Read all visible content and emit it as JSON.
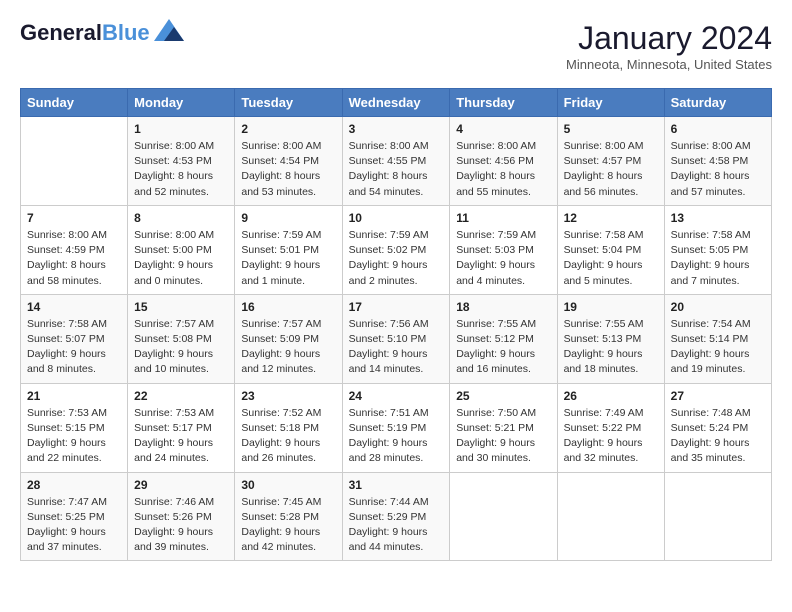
{
  "header": {
    "logo_line1": "General",
    "logo_line2": "Blue",
    "month": "January 2024",
    "location": "Minneota, Minnesota, United States"
  },
  "weekdays": [
    "Sunday",
    "Monday",
    "Tuesday",
    "Wednesday",
    "Thursday",
    "Friday",
    "Saturday"
  ],
  "weeks": [
    [
      {
        "day": "",
        "sunrise": "",
        "sunset": "",
        "daylight": ""
      },
      {
        "day": "1",
        "sunrise": "Sunrise: 8:00 AM",
        "sunset": "Sunset: 4:53 PM",
        "daylight": "Daylight: 8 hours and 52 minutes."
      },
      {
        "day": "2",
        "sunrise": "Sunrise: 8:00 AM",
        "sunset": "Sunset: 4:54 PM",
        "daylight": "Daylight: 8 hours and 53 minutes."
      },
      {
        "day": "3",
        "sunrise": "Sunrise: 8:00 AM",
        "sunset": "Sunset: 4:55 PM",
        "daylight": "Daylight: 8 hours and 54 minutes."
      },
      {
        "day": "4",
        "sunrise": "Sunrise: 8:00 AM",
        "sunset": "Sunset: 4:56 PM",
        "daylight": "Daylight: 8 hours and 55 minutes."
      },
      {
        "day": "5",
        "sunrise": "Sunrise: 8:00 AM",
        "sunset": "Sunset: 4:57 PM",
        "daylight": "Daylight: 8 hours and 56 minutes."
      },
      {
        "day": "6",
        "sunrise": "Sunrise: 8:00 AM",
        "sunset": "Sunset: 4:58 PM",
        "daylight": "Daylight: 8 hours and 57 minutes."
      }
    ],
    [
      {
        "day": "7",
        "sunrise": "Sunrise: 8:00 AM",
        "sunset": "Sunset: 4:59 PM",
        "daylight": "Daylight: 8 hours and 58 minutes."
      },
      {
        "day": "8",
        "sunrise": "Sunrise: 8:00 AM",
        "sunset": "Sunset: 5:00 PM",
        "daylight": "Daylight: 9 hours and 0 minutes."
      },
      {
        "day": "9",
        "sunrise": "Sunrise: 7:59 AM",
        "sunset": "Sunset: 5:01 PM",
        "daylight": "Daylight: 9 hours and 1 minute."
      },
      {
        "day": "10",
        "sunrise": "Sunrise: 7:59 AM",
        "sunset": "Sunset: 5:02 PM",
        "daylight": "Daylight: 9 hours and 2 minutes."
      },
      {
        "day": "11",
        "sunrise": "Sunrise: 7:59 AM",
        "sunset": "Sunset: 5:03 PM",
        "daylight": "Daylight: 9 hours and 4 minutes."
      },
      {
        "day": "12",
        "sunrise": "Sunrise: 7:58 AM",
        "sunset": "Sunset: 5:04 PM",
        "daylight": "Daylight: 9 hours and 5 minutes."
      },
      {
        "day": "13",
        "sunrise": "Sunrise: 7:58 AM",
        "sunset": "Sunset: 5:05 PM",
        "daylight": "Daylight: 9 hours and 7 minutes."
      }
    ],
    [
      {
        "day": "14",
        "sunrise": "Sunrise: 7:58 AM",
        "sunset": "Sunset: 5:07 PM",
        "daylight": "Daylight: 9 hours and 8 minutes."
      },
      {
        "day": "15",
        "sunrise": "Sunrise: 7:57 AM",
        "sunset": "Sunset: 5:08 PM",
        "daylight": "Daylight: 9 hours and 10 minutes."
      },
      {
        "day": "16",
        "sunrise": "Sunrise: 7:57 AM",
        "sunset": "Sunset: 5:09 PM",
        "daylight": "Daylight: 9 hours and 12 minutes."
      },
      {
        "day": "17",
        "sunrise": "Sunrise: 7:56 AM",
        "sunset": "Sunset: 5:10 PM",
        "daylight": "Daylight: 9 hours and 14 minutes."
      },
      {
        "day": "18",
        "sunrise": "Sunrise: 7:55 AM",
        "sunset": "Sunset: 5:12 PM",
        "daylight": "Daylight: 9 hours and 16 minutes."
      },
      {
        "day": "19",
        "sunrise": "Sunrise: 7:55 AM",
        "sunset": "Sunset: 5:13 PM",
        "daylight": "Daylight: 9 hours and 18 minutes."
      },
      {
        "day": "20",
        "sunrise": "Sunrise: 7:54 AM",
        "sunset": "Sunset: 5:14 PM",
        "daylight": "Daylight: 9 hours and 19 minutes."
      }
    ],
    [
      {
        "day": "21",
        "sunrise": "Sunrise: 7:53 AM",
        "sunset": "Sunset: 5:15 PM",
        "daylight": "Daylight: 9 hours and 22 minutes."
      },
      {
        "day": "22",
        "sunrise": "Sunrise: 7:53 AM",
        "sunset": "Sunset: 5:17 PM",
        "daylight": "Daylight: 9 hours and 24 minutes."
      },
      {
        "day": "23",
        "sunrise": "Sunrise: 7:52 AM",
        "sunset": "Sunset: 5:18 PM",
        "daylight": "Daylight: 9 hours and 26 minutes."
      },
      {
        "day": "24",
        "sunrise": "Sunrise: 7:51 AM",
        "sunset": "Sunset: 5:19 PM",
        "daylight": "Daylight: 9 hours and 28 minutes."
      },
      {
        "day": "25",
        "sunrise": "Sunrise: 7:50 AM",
        "sunset": "Sunset: 5:21 PM",
        "daylight": "Daylight: 9 hours and 30 minutes."
      },
      {
        "day": "26",
        "sunrise": "Sunrise: 7:49 AM",
        "sunset": "Sunset: 5:22 PM",
        "daylight": "Daylight: 9 hours and 32 minutes."
      },
      {
        "day": "27",
        "sunrise": "Sunrise: 7:48 AM",
        "sunset": "Sunset: 5:24 PM",
        "daylight": "Daylight: 9 hours and 35 minutes."
      }
    ],
    [
      {
        "day": "28",
        "sunrise": "Sunrise: 7:47 AM",
        "sunset": "Sunset: 5:25 PM",
        "daylight": "Daylight: 9 hours and 37 minutes."
      },
      {
        "day": "29",
        "sunrise": "Sunrise: 7:46 AM",
        "sunset": "Sunset: 5:26 PM",
        "daylight": "Daylight: 9 hours and 39 minutes."
      },
      {
        "day": "30",
        "sunrise": "Sunrise: 7:45 AM",
        "sunset": "Sunset: 5:28 PM",
        "daylight": "Daylight: 9 hours and 42 minutes."
      },
      {
        "day": "31",
        "sunrise": "Sunrise: 7:44 AM",
        "sunset": "Sunset: 5:29 PM",
        "daylight": "Daylight: 9 hours and 44 minutes."
      },
      {
        "day": "",
        "sunrise": "",
        "sunset": "",
        "daylight": ""
      },
      {
        "day": "",
        "sunrise": "",
        "sunset": "",
        "daylight": ""
      },
      {
        "day": "",
        "sunrise": "",
        "sunset": "",
        "daylight": ""
      }
    ]
  ]
}
